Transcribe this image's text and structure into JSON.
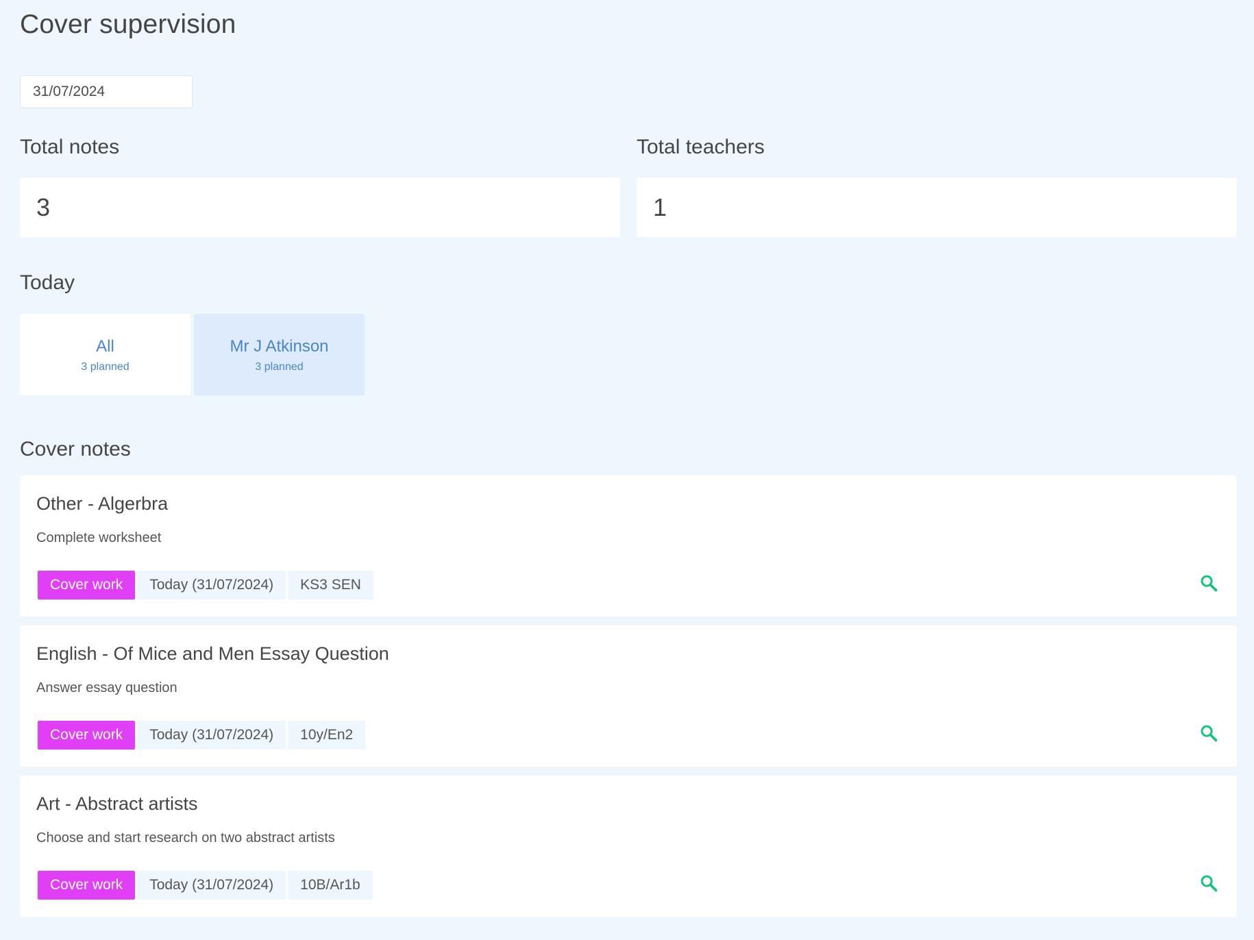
{
  "page": {
    "title": "Cover supervision"
  },
  "date_filter": {
    "value": "31/07/2024"
  },
  "stats": {
    "total_notes_label": "Total notes",
    "total_notes_value": "3",
    "total_teachers_label": "Total teachers",
    "total_teachers_value": "1"
  },
  "today": {
    "heading": "Today",
    "tabs": [
      {
        "name": "All",
        "count": "3 planned",
        "active": false
      },
      {
        "name": "Mr J Atkinson",
        "count": "3 planned",
        "active": true
      }
    ]
  },
  "cover_notes": {
    "heading": "Cover notes",
    "items": [
      {
        "title": "Other - Algerbra",
        "description": "Complete worksheet",
        "type_tag": "Cover work",
        "date_tag": "Today (31/07/2024)",
        "group_tag": "KS3 SEN"
      },
      {
        "title": "English - Of Mice and Men Essay Question",
        "description": "Answer essay question",
        "type_tag": "Cover work",
        "date_tag": "Today (31/07/2024)",
        "group_tag": "10y/En2"
      },
      {
        "title": "Art - Abstract artists",
        "description": "Choose and start research on two abstract artists",
        "type_tag": "Cover work",
        "date_tag": "Today (31/07/2024)",
        "group_tag": "10B/Ar1b"
      }
    ]
  },
  "icons": {
    "view": "search-icon"
  },
  "colors": {
    "background": "#eef6fe",
    "accent_tag": "#e13ef7",
    "link_blue": "#4a86c8",
    "active_tab": "#ddebfc",
    "search_icon": "#19c37d"
  }
}
